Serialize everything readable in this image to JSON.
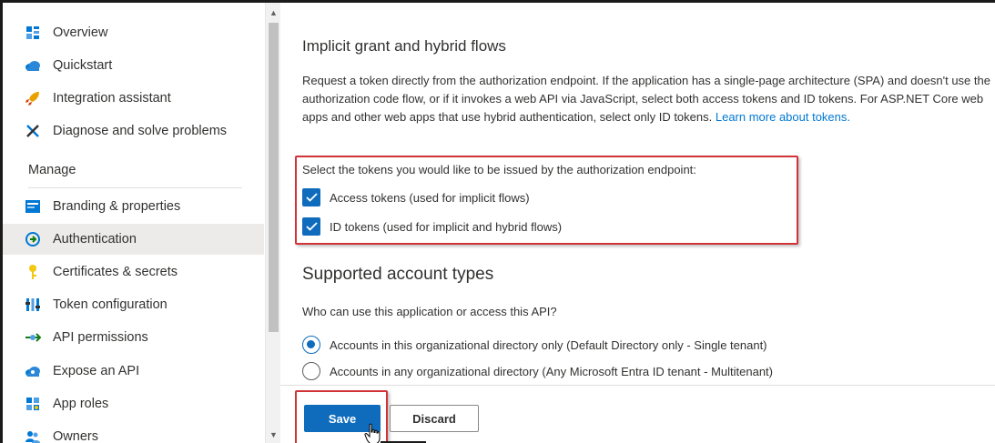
{
  "sidebar": {
    "items": [
      {
        "label": "Overview",
        "icon": "overview-icon",
        "color": "#0078d4"
      },
      {
        "label": "Quickstart",
        "icon": "quickstart-cloud-icon",
        "color": "#0078d4"
      },
      {
        "label": "Integration assistant",
        "icon": "rocket-icon",
        "color": "#e8a200"
      },
      {
        "label": "Diagnose and solve problems",
        "icon": "wrench-cross-icon",
        "color": "#0078d4"
      }
    ],
    "manage_heading": "Manage",
    "manage_items": [
      {
        "label": "Branding & properties",
        "icon": "branding-icon",
        "color": "#0078d4"
      },
      {
        "label": "Authentication",
        "icon": "authentication-icon",
        "color": "#107c10",
        "selected": true
      },
      {
        "label": "Certificates & secrets",
        "icon": "key-icon",
        "color": "#f2c811"
      },
      {
        "label": "Token configuration",
        "icon": "token-bars-icon",
        "color": "#0078d4"
      },
      {
        "label": "API permissions",
        "icon": "api-permissions-icon",
        "color": "#107c10"
      },
      {
        "label": "Expose an API",
        "icon": "cloud-api-icon",
        "color": "#0078d4"
      },
      {
        "label": "App roles",
        "icon": "app-roles-icon",
        "color": "#0078d4"
      },
      {
        "label": "Owners",
        "icon": "owners-icon",
        "color": "#0078d4"
      }
    ]
  },
  "implicit": {
    "heading": "Implicit grant and hybrid flows",
    "description": "Request a token directly from the authorization endpoint. If the application has a single-page architecture (SPA) and doesn't use the authorization code flow, or if it invokes a web API via JavaScript, select both access tokens and ID tokens. For ASP.NET Core web apps and other web apps that use hybrid authentication, select only ID tokens.",
    "learn_more": "Learn more about tokens.",
    "tokens_question": "Select the tokens you would like to be issued by the authorization endpoint:",
    "access_tokens_label": "Access tokens (used for implicit flows)",
    "access_tokens_checked": true,
    "id_tokens_label": "ID tokens (used for implicit and hybrid flows)",
    "id_tokens_checked": true
  },
  "account_types": {
    "heading": "Supported account types",
    "question": "Who can use this application or access this API?",
    "options": [
      {
        "label": "Accounts in this organizational directory only (Default Directory only - Single tenant)",
        "selected": true
      },
      {
        "label": "Accounts in any organizational directory (Any Microsoft Entra ID tenant - Multitenant)",
        "selected": false
      }
    ]
  },
  "actions": {
    "save_label": "Save",
    "discard_label": "Discard"
  },
  "colors": {
    "accent": "#0f6cbd",
    "highlight": "#d13438"
  }
}
